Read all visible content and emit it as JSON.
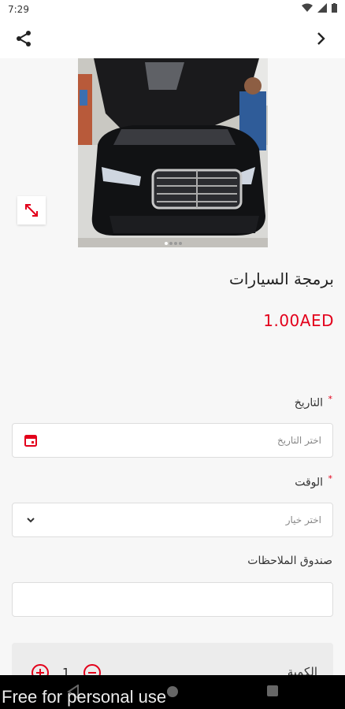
{
  "status_bar": {
    "time": "7:29"
  },
  "product": {
    "title": "برمجة السيارات",
    "price": "1.00AED",
    "image_count_dots": 4
  },
  "form": {
    "date": {
      "label": "التاريخ",
      "required_mark": "*",
      "placeholder": "اختر التاريخ"
    },
    "time": {
      "label": "الوقت",
      "required_mark": "*",
      "placeholder": "اختر خيار"
    },
    "notes": {
      "label": "صندوق الملاحظات",
      "value": ""
    },
    "quantity": {
      "label": "الكمية",
      "value": "1"
    }
  },
  "colors": {
    "accent": "#e3001b",
    "background": "#f7f7f7"
  },
  "icons": [
    "share-icon",
    "chevron-right-icon",
    "expand-icon",
    "calendar-icon",
    "chevron-down-icon",
    "plus-circle-icon",
    "minus-circle-icon"
  ],
  "watermark": "Free for personal use"
}
